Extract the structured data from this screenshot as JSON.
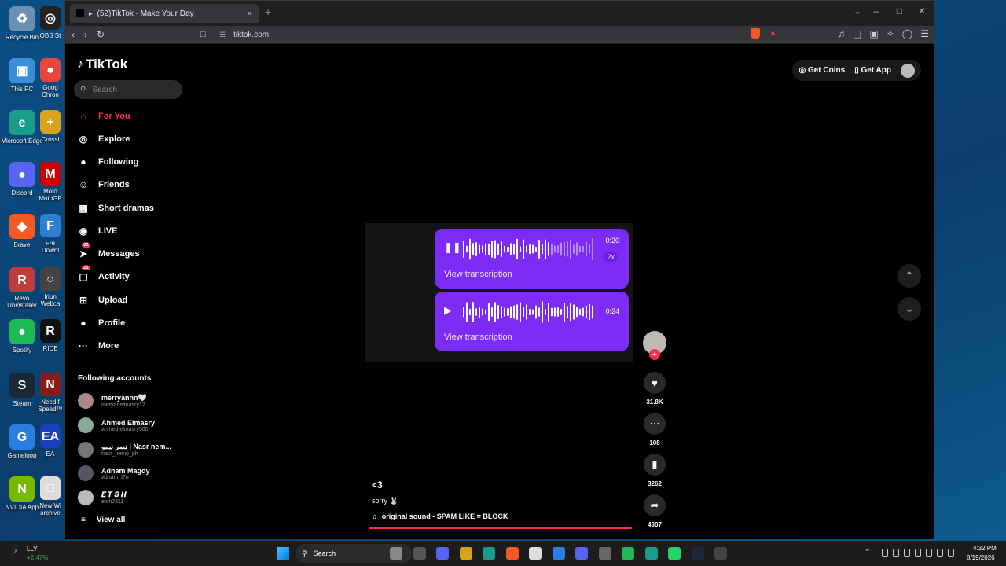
{
  "desktop": {
    "icons": [
      {
        "label": "Recycle Bin",
        "color": "#6b8fb0",
        "glyph": "♻"
      },
      {
        "label": "This PC",
        "color": "#3a8fd8",
        "glyph": "▣"
      },
      {
        "label": "Microsoft Edge",
        "color": "#1a9c8c",
        "glyph": "e"
      },
      {
        "label": "Discord",
        "color": "#5865f2",
        "glyph": "●"
      },
      {
        "label": "Brave",
        "color": "#f15a24",
        "glyph": "◆"
      },
      {
        "label": "Revo Uninstaller",
        "color": "#c23b3b",
        "glyph": "R"
      },
      {
        "label": "Spotify",
        "color": "#1db954",
        "glyph": "●"
      },
      {
        "label": "Steam",
        "color": "#1b2838",
        "glyph": "S"
      },
      {
        "label": "Gameloop",
        "color": "#2a7de1",
        "glyph": "G"
      },
      {
        "label": "NVIDIA App",
        "color": "#76b900",
        "glyph": "N"
      }
    ],
    "icons2": [
      {
        "label": "OBS St",
        "color": "#222",
        "glyph": "◎"
      },
      {
        "label": "Goog Chron",
        "color": "#e8453c",
        "glyph": "●"
      },
      {
        "label": "Crossl",
        "color": "#d9a21b",
        "glyph": "+"
      },
      {
        "label": "Moto MotoGP",
        "color": "#c00",
        "glyph": "M"
      },
      {
        "label": "Fre Downl",
        "color": "#2f7fd3",
        "glyph": "F"
      },
      {
        "label": "Iriun Webca",
        "color": "#444",
        "glyph": "○"
      },
      {
        "label": "RIDE",
        "color": "#111",
        "glyph": "R"
      },
      {
        "label": "Need f Speed™",
        "color": "#8b1a1a",
        "glyph": "N"
      },
      {
        "label": "EA",
        "color": "#1a3fbf",
        "glyph": "EA"
      },
      {
        "label": "New Wi archive",
        "color": "#ddd",
        "glyph": "□"
      }
    ]
  },
  "browser": {
    "tab_title": "(52)TikTok - Make Your Day",
    "new_tab": "+",
    "url": "tiktok.com"
  },
  "tiktok": {
    "logo": "TikTok",
    "search_placeholder": "Search",
    "nav": [
      {
        "label": "For You",
        "icon": "home-icon",
        "glyph": "⌂",
        "active": true
      },
      {
        "label": "Explore",
        "icon": "compass-icon",
        "glyph": "◎"
      },
      {
        "label": "Following",
        "icon": "following-avatar-icon",
        "glyph": "●"
      },
      {
        "label": "Friends",
        "icon": "friends-icon",
        "glyph": "☺"
      },
      {
        "label": "Short dramas",
        "icon": "film-icon",
        "glyph": "▦"
      },
      {
        "label": "LIVE",
        "icon": "live-icon",
        "glyph": "◉"
      },
      {
        "label": "Messages",
        "icon": "messages-icon",
        "glyph": "➤",
        "badge": "31"
      },
      {
        "label": "Activity",
        "icon": "activity-icon",
        "glyph": "▢",
        "badge": "21"
      },
      {
        "label": "Upload",
        "icon": "upload-icon",
        "glyph": "⊞"
      },
      {
        "label": "Profile",
        "icon": "profile-icon",
        "glyph": "●"
      },
      {
        "label": "More",
        "icon": "more-icon",
        "glyph": "···"
      }
    ],
    "following_title": "Following accounts",
    "accounts": [
      {
        "name": "merryannn🤍",
        "handle": "meryanelmasry12"
      },
      {
        "name": "Ahmed Elmasry",
        "handle": "ahmed.elmasry500"
      },
      {
        "name": "نصر نيمو | Nasr nem...",
        "handle": "nasr_nemo_ph"
      },
      {
        "name": "Adham Magdy",
        "handle": "adham_l7n"
      },
      {
        "name": "𝑬 𝑻 𝑺 𝑯",
        "handle": "etsh2311"
      }
    ],
    "view_all": "View all",
    "get_coins": "Get Coins",
    "get_app": "Get App",
    "video": {
      "voice1": {
        "time": "0:20",
        "speed": "2x",
        "transcription": "View transcription",
        "state": "pause"
      },
      "voice2": {
        "time": "0:24",
        "transcription": "View transcription",
        "state": "play"
      },
      "caption_title": "<3",
      "caption_sub": "sorry 🐰",
      "sound": "original sound - SPAM LIKE = BLOCK",
      "progress_fraction": 1.0
    },
    "actions": {
      "likes": "31.8K",
      "comments": "108",
      "saves": "3262",
      "shares": "4307"
    }
  },
  "taskbar": {
    "weather_ticker": "LLY",
    "weather_change": "+2.47%",
    "search": "Search",
    "time": "4:32 PM",
    "date": "8/19/2026"
  },
  "colors": {
    "accent": "#fe2c55",
    "voice_bubble": "#7d2cf5"
  }
}
